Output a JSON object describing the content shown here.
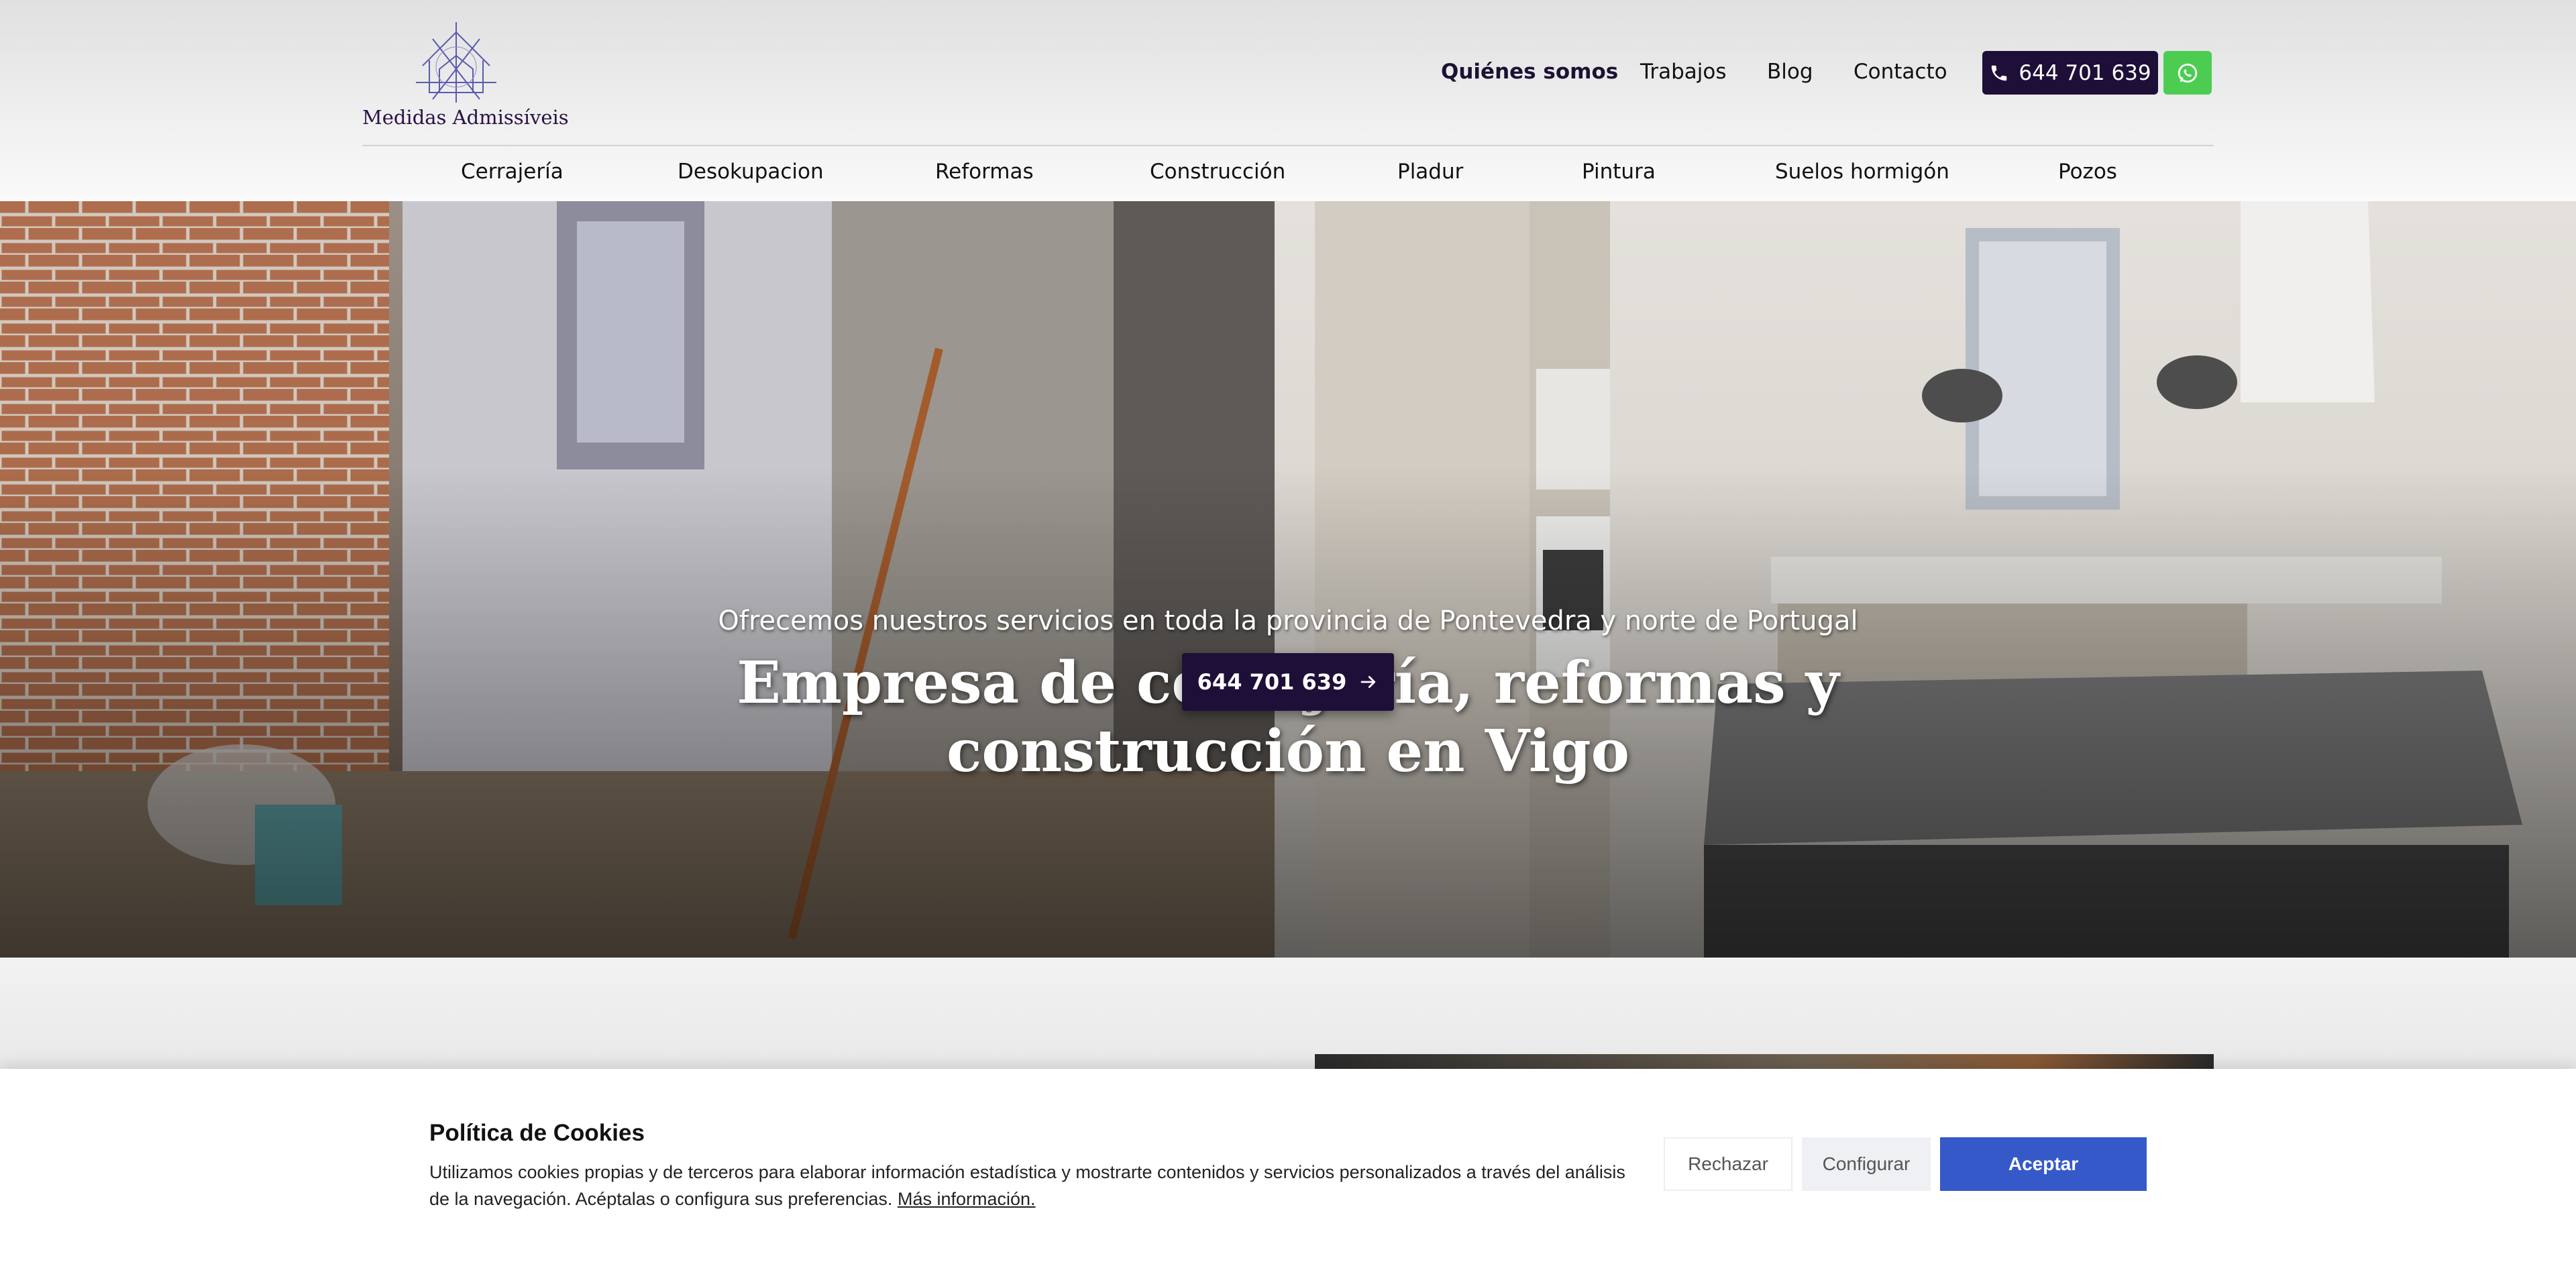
{
  "brand": {
    "name": "Medidas Admissíveis"
  },
  "header": {
    "nav": [
      {
        "label": "Quiénes somos",
        "active": true
      },
      {
        "label": "Trabajos"
      },
      {
        "label": "Blog"
      },
      {
        "label": "Contacto"
      }
    ],
    "phone": "644 701 639",
    "phone_icon": "phone-icon",
    "whatsapp_icon": "whatsapp-icon"
  },
  "services_nav": [
    "Cerrajería",
    "Desokupacion",
    "Reformas",
    "Construcción",
    "Pladur",
    "Pintura",
    "Suelos hormigón",
    "Pozos"
  ],
  "hero": {
    "title": "Empresa de cerrajería, reformas y construcción en Vigo",
    "subtitle": "Ofrecemos nuestros servicios en toda la provincia de Pontevedra y norte de Portugal",
    "cta_label": "644 701 639",
    "cta_icon": "arrow-right-icon"
  },
  "cookie": {
    "title": "Política de Cookies",
    "text": "Utilizamos cookies propias y de terceros para elaborar información estadística y mostrarte contenidos y servicios personalizados a través del análisis de la navegación. Acéptalas o configura sus preferencias.",
    "more_link": "Más información.",
    "reject": "Rechazar",
    "configure": "Configurar",
    "accept": "Aceptar"
  },
  "colors": {
    "primary": "#1e0f38",
    "whatsapp": "#4ccd52",
    "accept": "#3659c9"
  }
}
